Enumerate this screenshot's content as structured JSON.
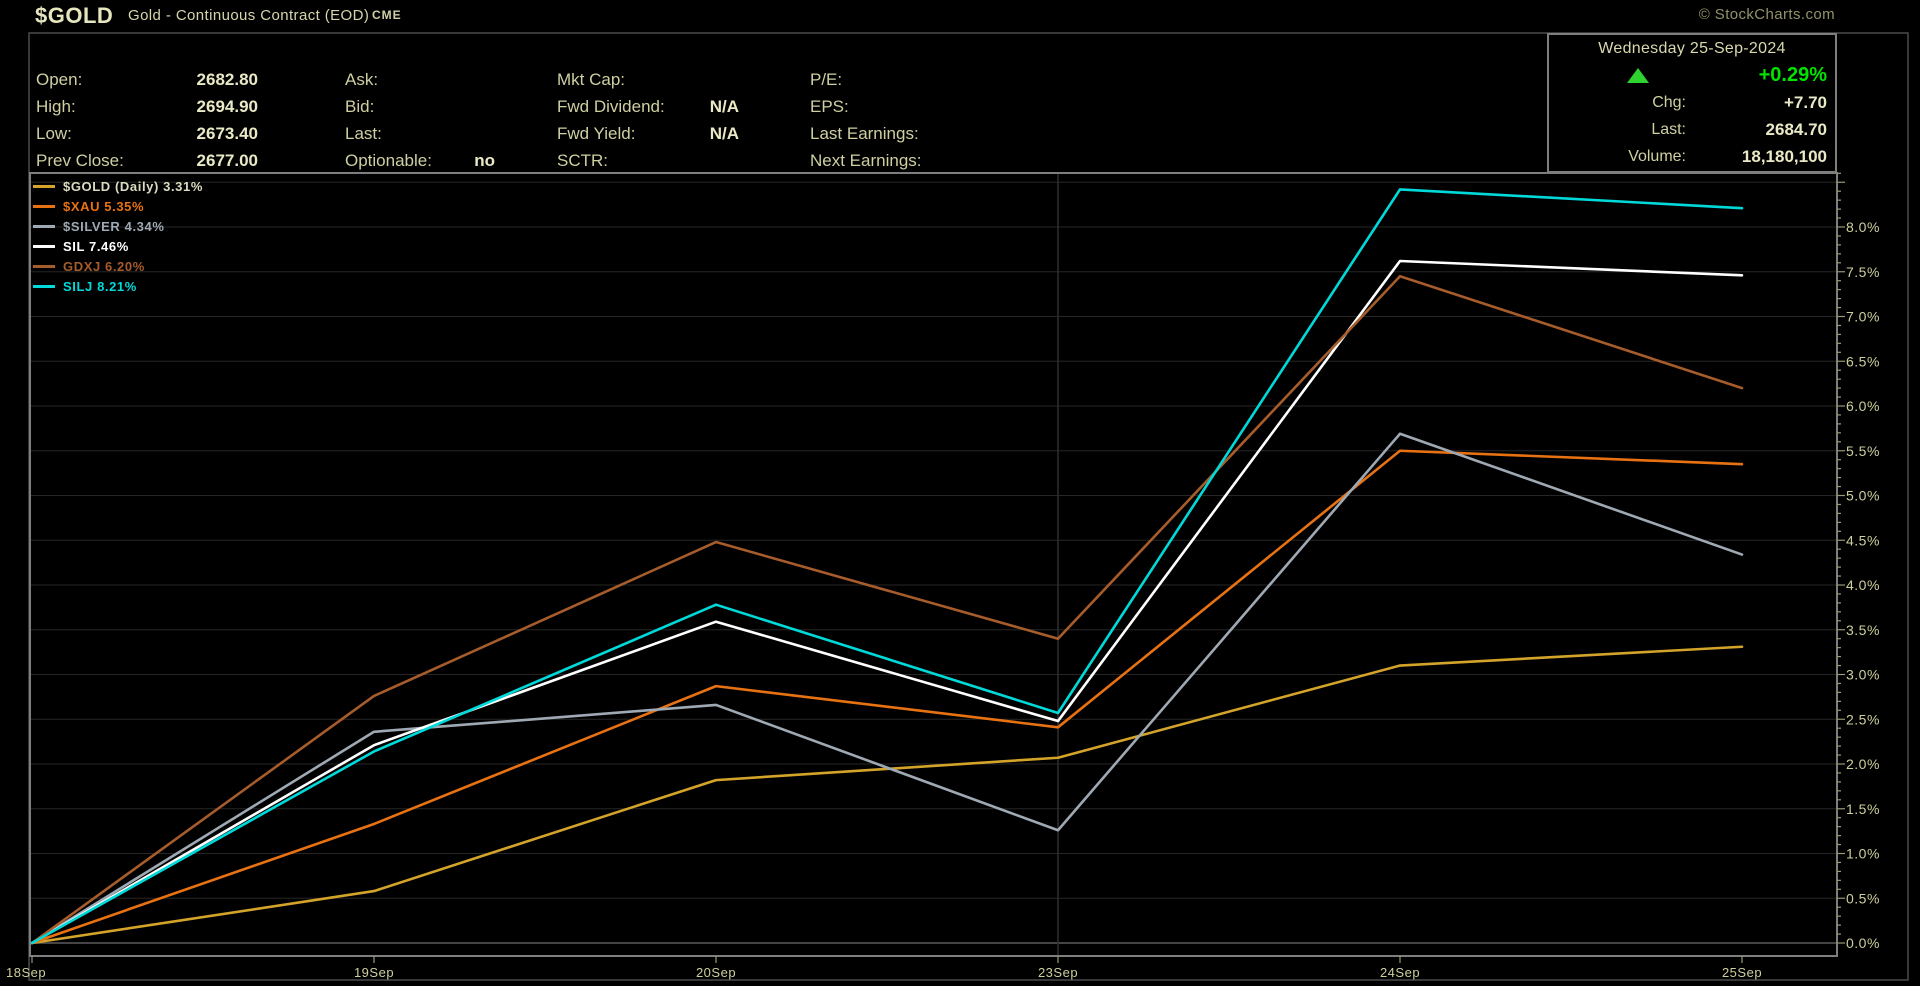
{
  "title": {
    "symbol": "$GOLD",
    "name": "Gold - Continuous Contract (EOD)",
    "exchange": "CME",
    "credit": "© StockCharts.com"
  },
  "quote": {
    "open": {
      "label": "Open:",
      "value": "2682.80"
    },
    "high": {
      "label": "High:",
      "value": "2694.90"
    },
    "low": {
      "label": "Low:",
      "value": "2673.40"
    },
    "prev_close": {
      "label": "Prev Close:",
      "value": "2677.00"
    },
    "ask": {
      "label": "Ask:",
      "value": ""
    },
    "bid": {
      "label": "Bid:",
      "value": ""
    },
    "last": {
      "label": "Last:",
      "value": ""
    },
    "optionable": {
      "label": "Optionable:",
      "value": "no"
    },
    "mkt_cap": {
      "label": "Mkt Cap:",
      "value": ""
    },
    "fwd_dividend": {
      "label": "Fwd Dividend:",
      "value": "N/A"
    },
    "fwd_yield": {
      "label": "Fwd Yield:",
      "value": "N/A"
    },
    "sctr": {
      "label": "SCTR:",
      "value": ""
    },
    "pe": {
      "label": "P/E:",
      "value": ""
    },
    "eps": {
      "label": "EPS:",
      "value": ""
    },
    "last_earnings": {
      "label": "Last Earnings:",
      "value": ""
    },
    "next_earnings": {
      "label": "Next Earnings:",
      "value": ""
    }
  },
  "datebox": {
    "date": "Wednesday 25-Sep-2024",
    "pct_change": "+0.29%",
    "chg": {
      "label": "Chg:",
      "value": "+7.70"
    },
    "last": {
      "label": "Last:",
      "value": "2684.70"
    },
    "volume": {
      "label": "Volume:",
      "value": "18,180,100"
    }
  },
  "colors": {
    "background": "#000000",
    "khaki_label": "#cfcfa2",
    "khaki_value": "#e9e9c5",
    "axis_text": "#cfcf9e",
    "accent_green": "#00e400",
    "triangle_green": "#2fd32f"
  },
  "chart_data": {
    "type": "line",
    "title": "$GOLD performance comparison (percent change since 18-Sep-2024)",
    "x_categories": [
      "18Sep",
      "19Sep",
      "20Sep",
      "23Sep",
      "24Sep",
      "25Sep"
    ],
    "week_start_category": "23Sep",
    "series": [
      {
        "name": "$GOLD (Daily)",
        "legend": "$GOLD (Daily) 3.31%",
        "final_pct": 3.31,
        "color": "#d4a42a",
        "legend_color": "#dcdcc0",
        "values": [
          0,
          0.58,
          1.82,
          2.07,
          3.1,
          3.31
        ]
      },
      {
        "name": "$XAU",
        "legend": "$XAU 5.35%",
        "final_pct": 5.35,
        "color": "#e87212",
        "values": [
          0,
          1.33,
          2.87,
          2.41,
          5.5,
          5.35
        ]
      },
      {
        "name": "$SILVER",
        "legend": "$SILVER 4.34%",
        "final_pct": 4.34,
        "color": "#9fa9b3",
        "values": [
          0,
          2.36,
          2.66,
          1.26,
          5.69,
          4.34
        ]
      },
      {
        "name": "SIL",
        "legend": "SIL 7.46%",
        "final_pct": 7.46,
        "color": "#ffffff",
        "values": [
          0,
          2.21,
          3.59,
          2.48,
          7.62,
          7.46
        ]
      },
      {
        "name": "GDXJ",
        "legend": "GDXJ 6.20%",
        "final_pct": 6.2,
        "color": "#a65c2b",
        "values": [
          0,
          2.76,
          4.48,
          3.4,
          7.45,
          6.2
        ]
      },
      {
        "name": "SILJ",
        "legend": "SILJ 8.21%",
        "final_pct": 8.21,
        "color": "#00d9d9",
        "values": [
          0,
          2.14,
          3.78,
          2.57,
          8.42,
          8.21
        ]
      }
    ],
    "y_axis": {
      "min": 0,
      "max": 8.6,
      "tick_step": 0.5,
      "minor_tick_step": 0.1,
      "labels": [
        "0.0%",
        "0.5%",
        "1.0%",
        "1.5%",
        "2.0%",
        "2.5%",
        "3.0%",
        "3.5%",
        "4.0%",
        "4.5%",
        "5.0%",
        "5.5%",
        "6.0%",
        "6.5%",
        "7.0%",
        "7.5%",
        "8.0%"
      ]
    },
    "grid": true,
    "legend_position": "top-left"
  }
}
